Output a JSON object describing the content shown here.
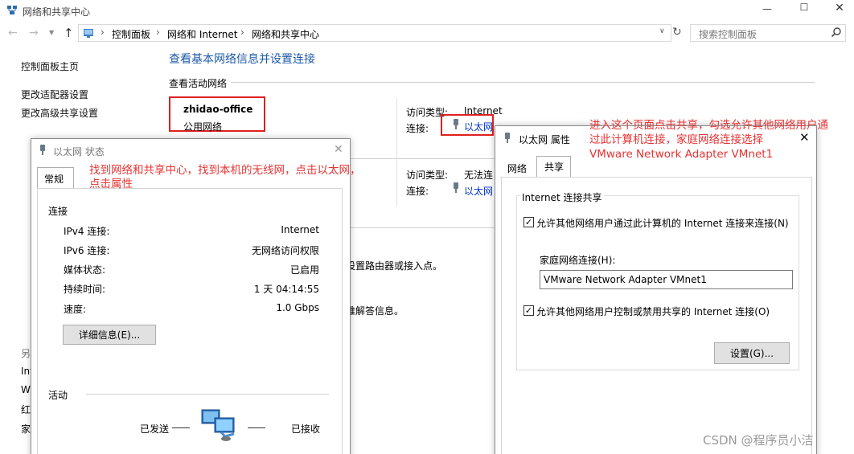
{
  "main": {
    "title": "网络和共享中心",
    "breadcrumb": [
      "控制面板",
      "网络和 Internet",
      "网络和共享中心"
    ],
    "search_placeholder": "搜索控制面板",
    "left_nav": {
      "home": "控制面板主页",
      "adapter": "更改适配器设置",
      "advanced": "更改高级共享设置",
      "also_see_fragments": [
        "另",
        "Int",
        "W",
        "红",
        "家"
      ]
    },
    "heading": "查看基本网络信息并设置连接",
    "active_networks": "查看活动网络",
    "network1": {
      "name": "zhidao-office",
      "type": "公用网络",
      "access_label": "访问类型:",
      "access_value": "Internet",
      "conn_label": "连接:",
      "conn_value": "以太网"
    },
    "network2": {
      "access_label": "访问类型:",
      "access_value": "无法连",
      "conn_label": "连接:",
      "conn_value": "以太网"
    },
    "fragment1": "设置路由器或接入点。",
    "fragment2": "难解答信息。"
  },
  "status_dialog": {
    "title": "以太网 状态",
    "tab": "常规",
    "connection_group": "连接",
    "rows": [
      {
        "label": "IPv4 连接:",
        "value": "Internet"
      },
      {
        "label": "IPv6 连接:",
        "value": "无网络访问权限"
      },
      {
        "label": "媒体状态:",
        "value": "已启用"
      },
      {
        "label": "持续时间:",
        "value": "1 天 04:14:55"
      },
      {
        "label": "速度:",
        "value": "1.0 Gbps"
      }
    ],
    "details_button": "详细信息(E)...",
    "activity_group": "活动",
    "sent": "已发送",
    "received": "已接收"
  },
  "props_dialog": {
    "title": "以太网 属性",
    "tabs": [
      "网络",
      "共享"
    ],
    "group": "Internet 连接共享",
    "allow_share": "允许其他网络用户通过此计算机的 Internet 连接来连接(N)",
    "home_label": "家庭网络连接(H):",
    "home_value": "VMware Network Adapter VMnet1",
    "allow_control": "允许其他网络用户控制或禁用共享的 Internet 连接(O)",
    "settings_button": "设置(G)..."
  },
  "annotations": {
    "a1_line1": "找到网络和共享中心，找到本机的无线网，点击以太网，",
    "a1_line2": "点击属性",
    "a2_line1": "进入这个页面点击共享，勾选允许其他网络用户通",
    "a2_line2": "过此计算机连接，家庭网络连接选择",
    "a2_line3": "VMware Network Adapter VMnet1"
  },
  "watermark": "CSDN @程序员小洁",
  "colors": {
    "link": "#0033cc",
    "heading": "#1e5aa8",
    "annotation": "#e53333",
    "highlight_box": "#e02020"
  }
}
